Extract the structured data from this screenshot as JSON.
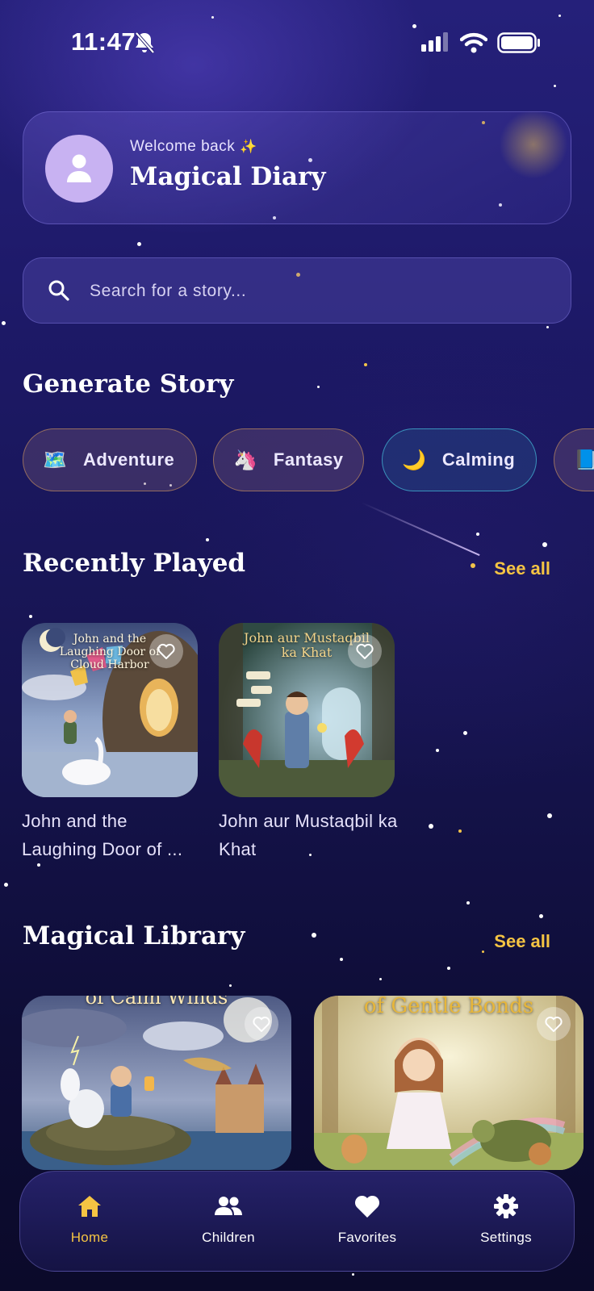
{
  "status_bar": {
    "time": "11:47"
  },
  "header": {
    "welcome": "Welcome back",
    "title": "Magical Diary"
  },
  "search": {
    "placeholder": "Search for a story..."
  },
  "generate": {
    "title": "Generate Story",
    "chips": [
      {
        "emoji": "🗺️",
        "label": "Adventure"
      },
      {
        "emoji": "🦄",
        "label": "Fantasy"
      },
      {
        "emoji": "🌙",
        "label": "Calming"
      },
      {
        "emoji": "📘",
        "label": ""
      }
    ]
  },
  "recently_played": {
    "title": "Recently Played",
    "see_all": "See all",
    "items": [
      {
        "thumb_title": "John and the Laughing Door of Cloud Harbor",
        "title": "John and the Laughing Door of ..."
      },
      {
        "thumb_title": "John aur Mustaqbil ka Khat",
        "title": "John aur Mustaqbil ka Khat"
      }
    ]
  },
  "library": {
    "title": "Magical Library",
    "see_all": "See all",
    "items": [
      {
        "thumb_title": "of Calm Winds"
      },
      {
        "thumb_title": "of Gentle Bonds"
      }
    ]
  },
  "nav": {
    "items": [
      {
        "label": "Home",
        "icon": "home-icon",
        "active": true
      },
      {
        "label": "Children",
        "icon": "people-icon"
      },
      {
        "label": "Favorites",
        "icon": "heart-icon"
      },
      {
        "label": "Settings",
        "icon": "gear-icon"
      }
    ]
  },
  "colors": {
    "accent": "#f5c443",
    "background": "#1d1967",
    "avatar": "#c8b2f2"
  }
}
